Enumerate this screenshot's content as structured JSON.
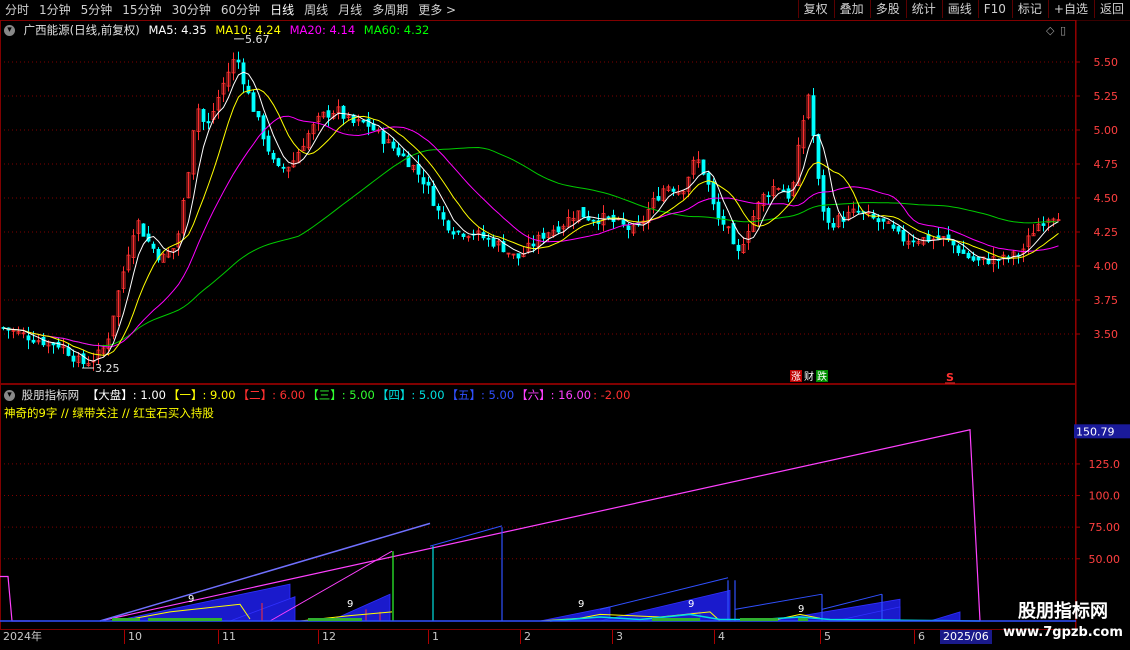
{
  "toolbar": {
    "periods": [
      "分时",
      "1分钟",
      "5分钟",
      "15分钟",
      "30分钟",
      "60分钟",
      "日线",
      "周线",
      "月线",
      "多周期",
      "更多 >"
    ],
    "active_period": "日线",
    "buttons": [
      "复权",
      "叠加",
      "多股",
      "统计",
      "画线",
      "F10",
      "标记",
      "+自选",
      "返回"
    ]
  },
  "stock": {
    "name": "广西能源(日线,前复权)",
    "ma5": "MA5: 4.35",
    "ma10": "MA10: 4.24",
    "ma20": "MA20: 4.14",
    "ma60": "MA60: 4.32"
  },
  "price_axis": {
    "labels": [
      "5.50",
      "5.25",
      "5.00",
      "4.75",
      "4.50",
      "4.25",
      "4.00",
      "3.75",
      "3.50"
    ],
    "high_label": "5.67",
    "low_label": "3.25"
  },
  "markers": {
    "zhang": "涨",
    "cai": "财",
    "die": "跌",
    "s": "S"
  },
  "indicator": {
    "name": "股朋指标网",
    "items": [
      {
        "label": "【大盘】",
        "value": ": 1.00",
        "color": "#ffffff"
      },
      {
        "label": "【一】",
        "value": ": 9.00",
        "color": "#ffff00"
      },
      {
        "label": "【二】",
        "value": ": 6.00",
        "color": "#ff3030"
      },
      {
        "label": "【三】",
        "value": ": 5.00",
        "color": "#30ff30"
      },
      {
        "label": "【四】",
        "value": ": 5.00",
        "color": "#00e0e0"
      },
      {
        "label": "【五】",
        "value": ": 5.00",
        "color": "#3050ff"
      },
      {
        "label": "【六】",
        "value": ": 16.00",
        "color": "#ff40ff"
      },
      {
        "label": "",
        "value": ": -2.00",
        "color": "#ff3030"
      }
    ],
    "subtitle": "神奇的9字 // 绿带关注 // 红宝石买入持股",
    "axis_labels": [
      "150.79",
      "125.0",
      "100.0",
      "75.00",
      "50.00"
    ],
    "nine_labels": [
      "9",
      "9",
      "9",
      "9",
      "9"
    ]
  },
  "dates": [
    "2024年",
    "10",
    "11",
    "12",
    "1",
    "2",
    "3",
    "4",
    "5",
    "6",
    "2025/06"
  ],
  "watermark": {
    "title": "股朋指标网",
    "url": "www.7gpzb.com"
  },
  "colors": {
    "up": "#ff3030",
    "down": "#00ffff",
    "ma5": "#ffffff",
    "ma10": "#ffff00",
    "ma20": "#ff00ff",
    "ma60": "#00cc00",
    "grid": "#800000"
  }
}
